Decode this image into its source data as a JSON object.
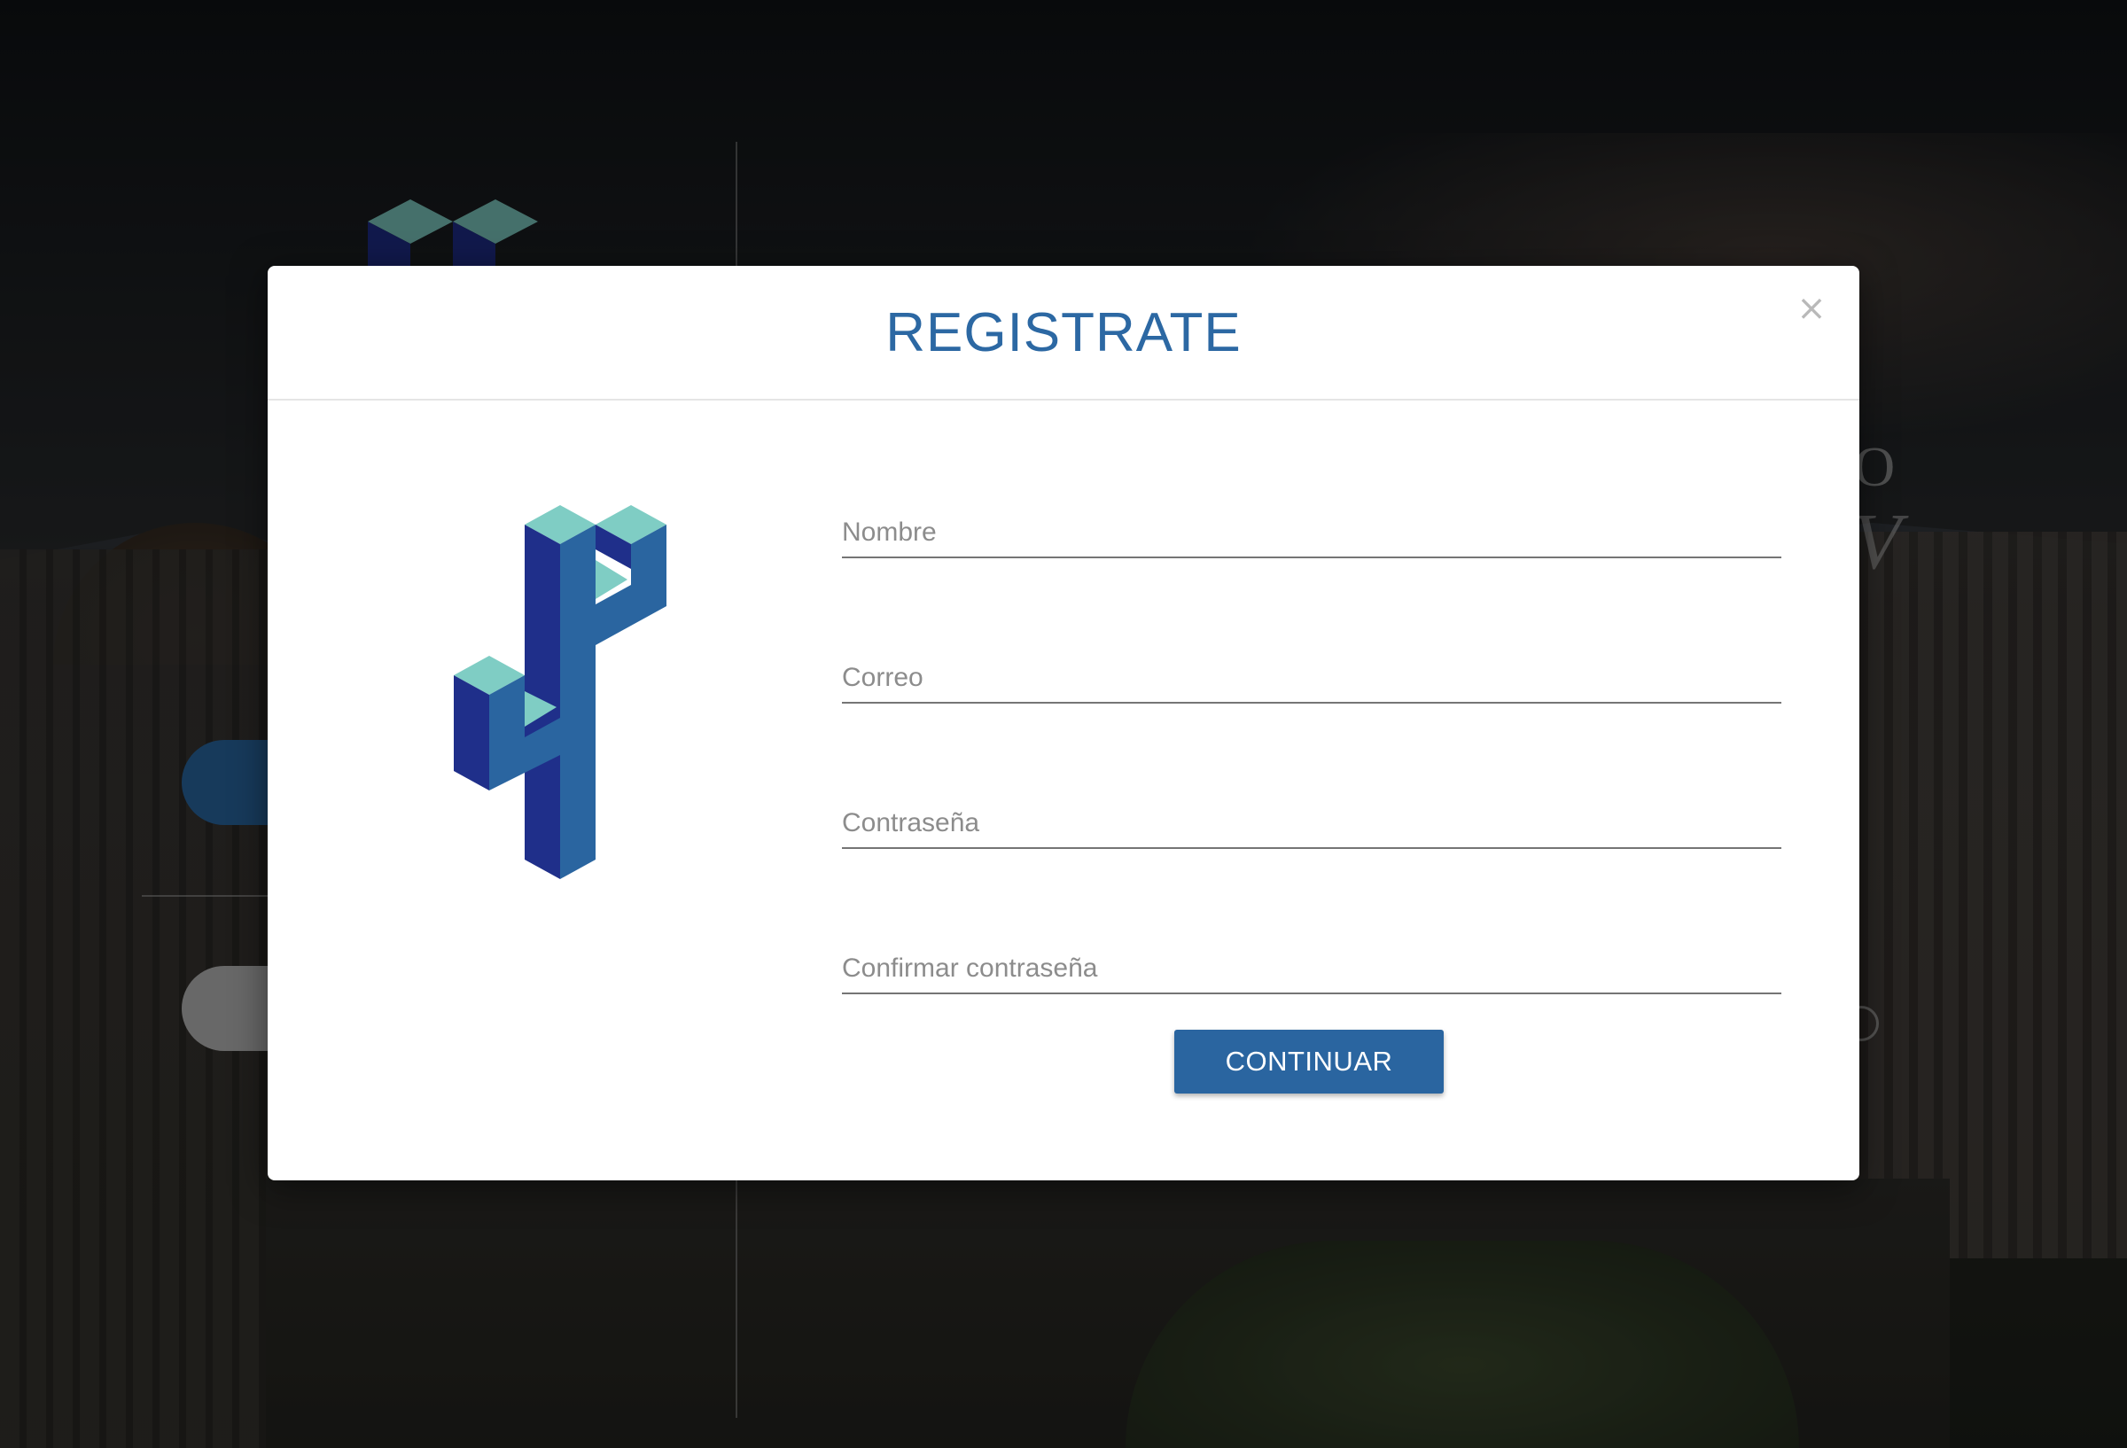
{
  "modal": {
    "title": "REGISTRATE",
    "close_label": "×",
    "logo_icon": "isometric-cube-logo-icon",
    "fields": {
      "name": {
        "placeholder": "Nombre",
        "value": ""
      },
      "email": {
        "placeholder": "Correo",
        "value": ""
      },
      "password": {
        "placeholder": "Contraseña",
        "value": ""
      },
      "confirm_password": {
        "placeholder": "Confirmar contraseña",
        "value": ""
      }
    },
    "continue_label": "CONTINUAR"
  },
  "background": {
    "right_glyph_o": "O",
    "right_glyph_v": "V"
  },
  "colors": {
    "accent": "#2c68a3",
    "button": "#2a65a0",
    "logo_teal": "#7fcdc4",
    "logo_blue_dark": "#1f2f8a",
    "logo_blue_mid": "#2a65a0"
  }
}
